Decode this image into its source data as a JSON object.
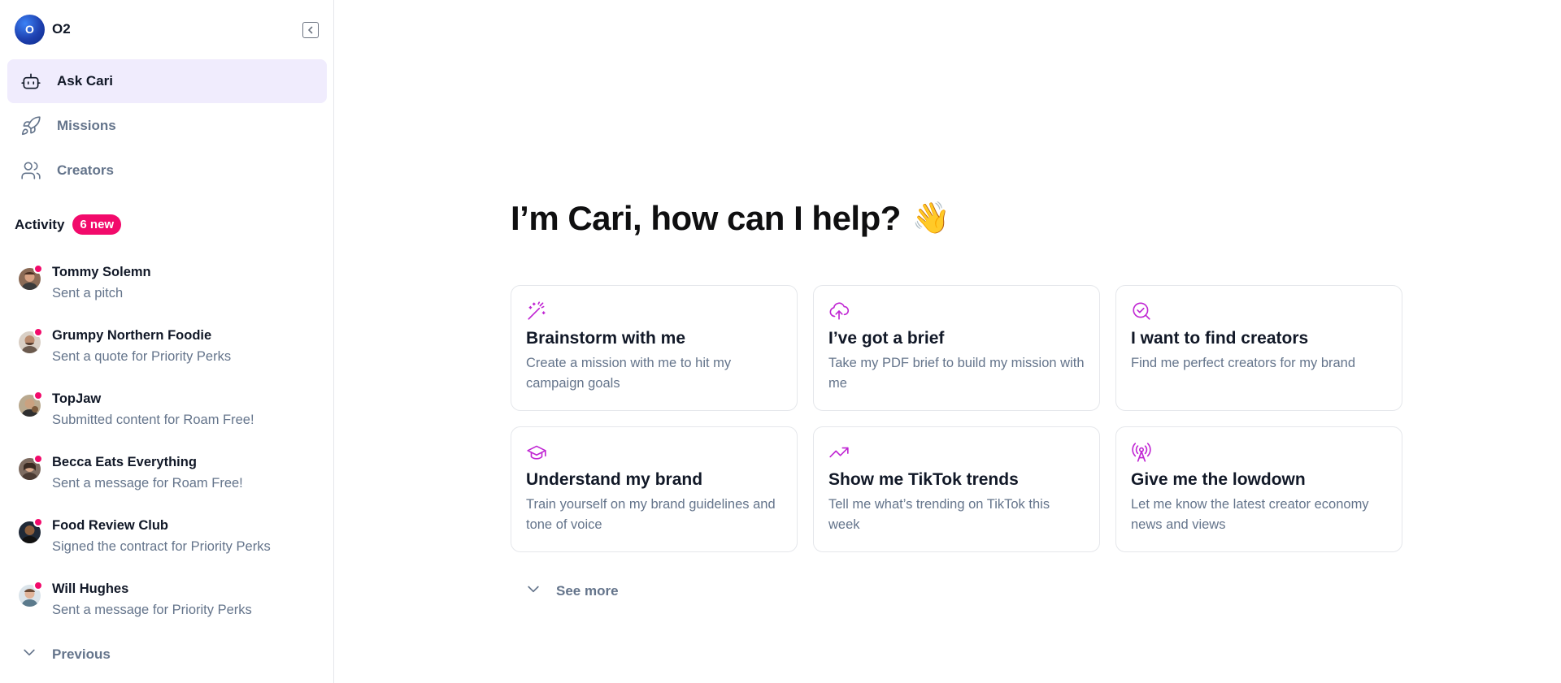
{
  "brand": {
    "logo_text": "O",
    "name": "O2"
  },
  "nav": [
    {
      "label": "Ask Cari",
      "icon": "robot-icon",
      "active": true
    },
    {
      "label": "Missions",
      "icon": "rocket-icon",
      "active": false
    },
    {
      "label": "Creators",
      "icon": "users-icon",
      "active": false
    }
  ],
  "activity": {
    "title": "Activity",
    "badge": "6 new",
    "items": [
      {
        "name": "Tommy Solemn",
        "desc": "Sent a pitch"
      },
      {
        "name": "Grumpy Northern Foodie",
        "desc": "Sent a quote for Priority Perks"
      },
      {
        "name": "TopJaw",
        "desc": "Submitted content for Roam Free!"
      },
      {
        "name": "Becca Eats Everything",
        "desc": "Sent a message for Roam Free!"
      },
      {
        "name": "Food Review Club",
        "desc": "Signed the contract for Priority Perks"
      },
      {
        "name": "Will Hughes",
        "desc": "Sent a message for Priority Perks"
      }
    ],
    "previous_label": "Previous"
  },
  "main": {
    "headline": "I’m Cari, how can I help?",
    "wave_emoji": "👋",
    "cards": [
      {
        "icon": "magic-wand-icon",
        "title": "Brainstorm with me",
        "desc": "Create a mission with me to hit my campaign goals"
      },
      {
        "icon": "cloud-upload-icon",
        "title": "I’ve got a brief",
        "desc": "Take my PDF brief to build my mission with me"
      },
      {
        "icon": "search-check-icon",
        "title": "I want to find creators",
        "desc": "Find me perfect creators for my brand"
      },
      {
        "icon": "graduation-cap-icon",
        "title": "Understand my brand",
        "desc": "Train yourself on my brand guidelines and tone of voice"
      },
      {
        "icon": "trending-up-icon",
        "title": "Show me TikTok trends",
        "desc": "Tell me what’s trending on TikTok this week"
      },
      {
        "icon": "broadcast-icon",
        "title": "Give me the lowdown",
        "desc": "Let me know the latest creator economy news and views"
      }
    ],
    "see_more_label": "See more"
  },
  "colors": {
    "accent": "#c026d3",
    "badge": "#f20a6b",
    "active_bg": "#f0ecfd",
    "muted": "#64748b"
  }
}
